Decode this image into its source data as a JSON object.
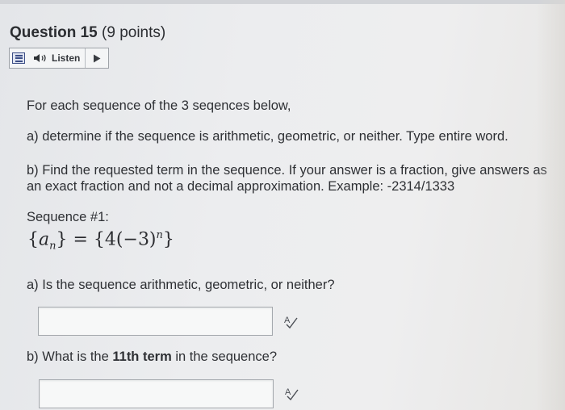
{
  "question": {
    "label": "Question 15",
    "points": "(9 points)"
  },
  "toolbar": {
    "listen_label": "Listen",
    "menu_icon": "list-menu-icon",
    "speaker_icon": "speaker-icon",
    "play_icon": "play-icon"
  },
  "body": {
    "intro": "For each sequence of the 3 seqences below,",
    "instruction_a": "a) determine if the sequence is arithmetic, geometric, or neither. Type entire word.",
    "instruction_b": "b) Find the requested term in the sequence. If your answer is a fraction, give answers as an exact fraction and not a decimal approximation. Example:  -2314/1333",
    "sequence_label": "Sequence #1:"
  },
  "formula": {
    "lhs_var": "a",
    "lhs_sub": "n",
    "rhs_coef": "4",
    "rhs_base": "(−3)",
    "rhs_exp": "n"
  },
  "question_a": {
    "prompt": "a) Is the sequence arithmetic, geometric, or neither?",
    "value": "",
    "placeholder": ""
  },
  "question_b": {
    "prompt_pre": "b) What is the ",
    "prompt_bold": "11th term",
    "prompt_post": " in the sequence?",
    "value": "",
    "placeholder": ""
  },
  "colors": {
    "accent_navy": "#3c4e86",
    "text": "#2e3034"
  }
}
